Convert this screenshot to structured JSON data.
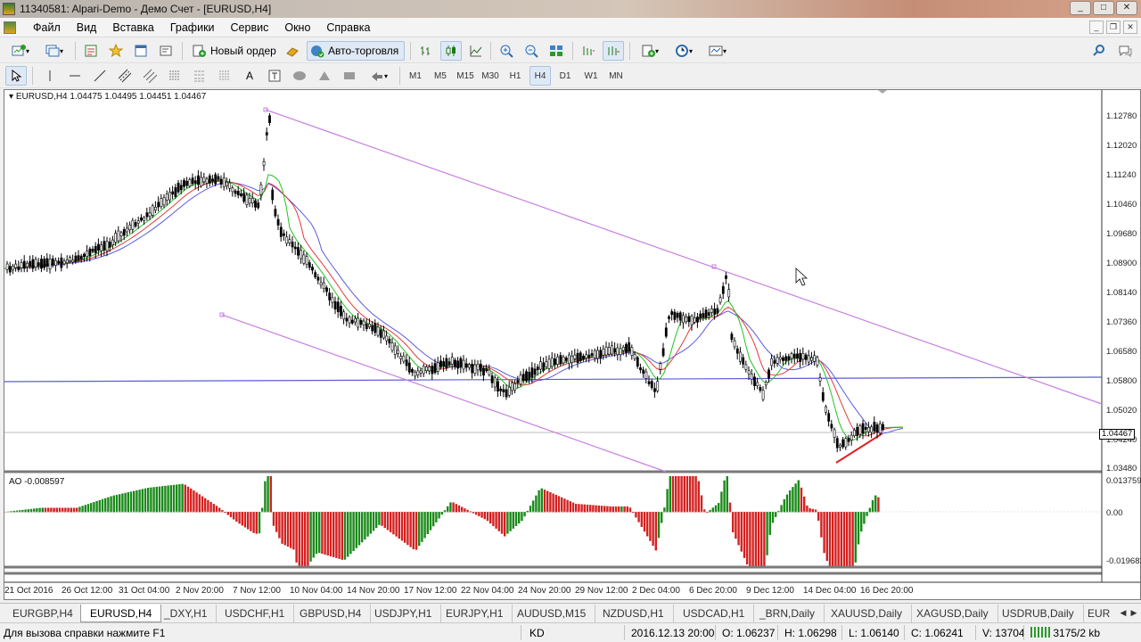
{
  "window": {
    "title": "11340581: Alpari-Demo - Демо Счет - [EURUSD,H4]",
    "buttons": [
      "_",
      "□",
      "✕"
    ]
  },
  "menu": {
    "items": [
      "Файл",
      "Вид",
      "Вставка",
      "Графики",
      "Сервис",
      "Окно",
      "Справка"
    ],
    "mdi_buttons": [
      "_",
      "❐",
      "✕"
    ]
  },
  "toolbar1": {
    "new_order": "Новый ордер",
    "auto_trading": "Авто-торговля"
  },
  "toolbar2": {
    "timeframes": [
      "M1",
      "M5",
      "M15",
      "M30",
      "H1",
      "H4",
      "D1",
      "W1",
      "MN"
    ],
    "active_timeframe": "H4",
    "text_tool": "A"
  },
  "chart": {
    "symbol_info": "EURUSD,H4  1.04475 1.04495 1.04451 1.04467",
    "ao_info": "AO -0.008597",
    "current_price": "1.04467",
    "price_labels": [
      "1.12780",
      "1.12020",
      "1.11240",
      "1.10460",
      "1.09680",
      "1.08900",
      "1.08140",
      "1.07360",
      "1.06580",
      "1.05800",
      "1.05020",
      "1.04240",
      "1.03480"
    ],
    "ao_labels": [
      "0.013759",
      "0.00",
      "-0.019682"
    ],
    "time_labels": [
      "21 Oct 2016",
      "26 Oct 12:00",
      "31 Oct 04:00",
      "2 Nov 20:00",
      "7 Nov 12:00",
      "10 Nov 04:00",
      "14 Nov 20:00",
      "17 Nov 12:00",
      "22 Nov 04:00",
      "24 Nov 20:00",
      "29 Nov 12:00",
      "2 Dec 04:00",
      "6 Dec 20:00",
      "9 Dec 12:00",
      "14 Dec 04:00",
      "16 Dec 20:00"
    ],
    "colors": {
      "bull": "#1a8a1a",
      "bear": "#d42020",
      "channel": "#c77fe0",
      "hline": "#5b5bd6",
      "ma_fast": "#22c322",
      "ma_mid": "#e03a3a",
      "ma_slow": "#5a5ae0"
    }
  },
  "tabs": {
    "items": [
      "EURGBP,H4",
      "EURUSD,H4",
      "_DXY,H1",
      "USDCHF,H1",
      "GBPUSD,H4",
      "USDJPY,H1",
      "EURJPY,H1",
      "AUDUSD,M15",
      "NZDUSD,H1",
      "USDCAD,H1",
      "_BRN,Daily",
      "XAUUSD,Daily",
      "XAGUSD,Daily",
      "USDRUB,Daily",
      "EUR"
    ],
    "active": "EURUSD,H4"
  },
  "status": {
    "help": "Для вызова справки нажмите F1",
    "profile": "KD",
    "datetime": "2016.12.13 20:00",
    "open": "O: 1.06237",
    "high": "H: 1.06298",
    "low": "L: 1.06140",
    "close": "C: 1.06241",
    "volume": "V: 13704",
    "traffic": "3175/2 kb"
  }
}
